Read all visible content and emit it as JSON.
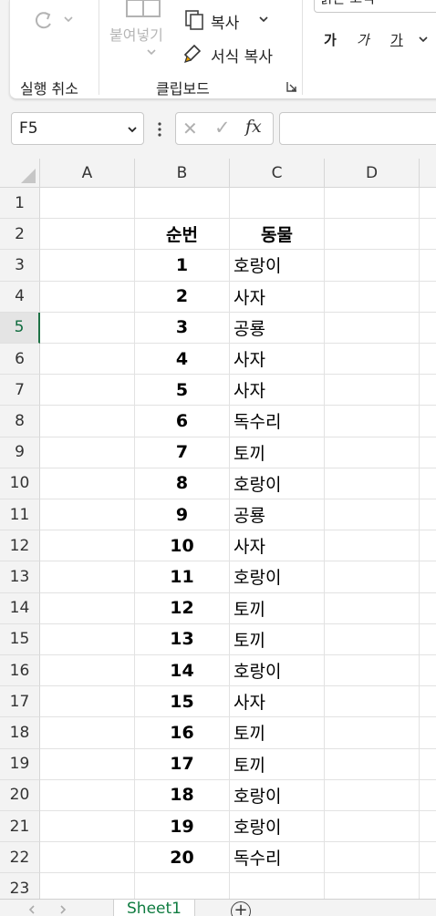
{
  "ribbon": {
    "undo_label": "실행 취소",
    "paste_label": "붙여넣기",
    "copy_label": "복사",
    "format_painter_label": "서식 복사",
    "clipboard_label": "클립보드",
    "font_name_partial": "맑은 고딕",
    "bold_glyph": "가",
    "italic_glyph": "가",
    "underline_glyph": "가"
  },
  "formula_bar": {
    "name_box": "F5",
    "cancel_glyph": "✕",
    "enter_glyph": "✓",
    "fx_label": "fx",
    "formula_value": ""
  },
  "grid": {
    "columns": [
      "A",
      "B",
      "C",
      "D"
    ],
    "active_row": 5,
    "rows": [
      {
        "num": "1",
        "b": "",
        "c": ""
      },
      {
        "num": "2",
        "b": "순번",
        "c": "동물"
      },
      {
        "num": "3",
        "b": "1",
        "c": "호랑이"
      },
      {
        "num": "4",
        "b": "2",
        "c": "사자"
      },
      {
        "num": "5",
        "b": "3",
        "c": "공룡"
      },
      {
        "num": "6",
        "b": "4",
        "c": "사자"
      },
      {
        "num": "7",
        "b": "5",
        "c": "사자"
      },
      {
        "num": "8",
        "b": "6",
        "c": "독수리"
      },
      {
        "num": "9",
        "b": "7",
        "c": "토끼"
      },
      {
        "num": "10",
        "b": "8",
        "c": "호랑이"
      },
      {
        "num": "11",
        "b": "9",
        "c": "공룡"
      },
      {
        "num": "12",
        "b": "10",
        "c": "사자"
      },
      {
        "num": "13",
        "b": "11",
        "c": "호랑이"
      },
      {
        "num": "14",
        "b": "12",
        "c": "토끼"
      },
      {
        "num": "15",
        "b": "13",
        "c": "토끼"
      },
      {
        "num": "16",
        "b": "14",
        "c": "호랑이"
      },
      {
        "num": "17",
        "b": "15",
        "c": "사자"
      },
      {
        "num": "18",
        "b": "16",
        "c": "토끼"
      },
      {
        "num": "19",
        "b": "17",
        "c": "토끼"
      },
      {
        "num": "20",
        "b": "18",
        "c": "호랑이"
      },
      {
        "num": "21",
        "b": "19",
        "c": "호랑이"
      },
      {
        "num": "22",
        "b": "20",
        "c": "독수리"
      },
      {
        "num": "23",
        "b": "",
        "c": ""
      }
    ]
  },
  "sheets": {
    "active_tab": "Sheet1",
    "add_glyph": "+"
  },
  "colors": {
    "accent": "#107c41",
    "header_bg": "#f3f3f3",
    "gridline": "#e2e2e2"
  }
}
